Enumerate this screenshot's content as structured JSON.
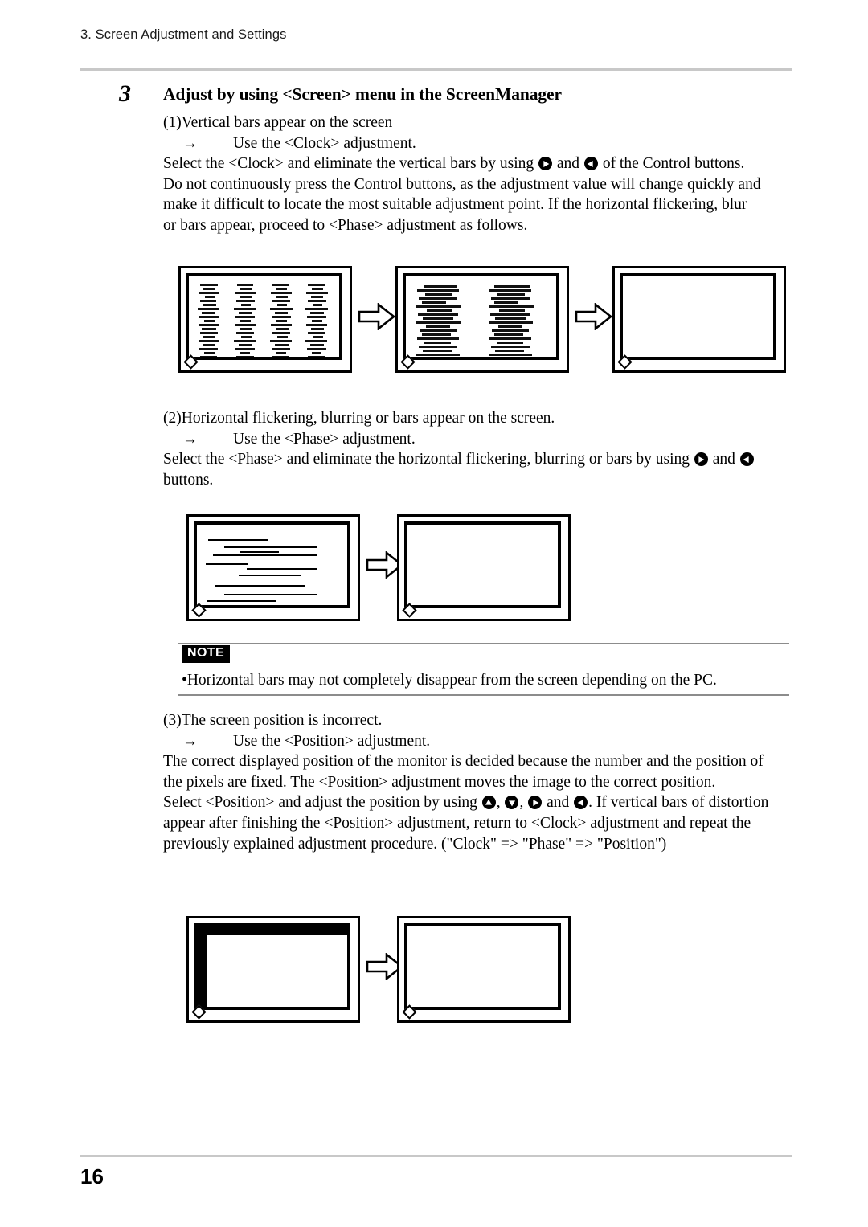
{
  "document": {
    "running_head": "3. Screen Adjustment and Settings",
    "page_number": "16"
  },
  "step": {
    "number": "3",
    "title": "Adjust by using <Screen> menu in the ScreenManager"
  },
  "sections": [
    {
      "id": "clock",
      "heading": "(1)Vertical bars appear on the screen",
      "arrow_symbol": "→",
      "arrow_instruction": "Use the <Clock> adjustment.",
      "paragraph_lines": [
        "Select the <Clock> and eliminate the vertical bars by using ",
        " and ",
        " of the Control buttons.",
        "Do not continuously press the Control buttons, as the adjustment value will change quickly and",
        "make it difficult to locate the most suitable adjustment point. If the horizontal flickering, blur",
        "or bars appear, proceed to <Phase> adjustment as follows."
      ],
      "buttons": [
        "right-control-button",
        "left-control-button"
      ]
    },
    {
      "id": "phase",
      "heading": "(2)Horizontal flickering, blurring or bars appear on the screen.",
      "arrow_symbol": "→",
      "arrow_instruction": "Use the <Phase> adjustment.",
      "paragraph_lines": [
        "Select the <Phase> and eliminate the horizontal flickering, blurring or bars by using ",
        " and ",
        "",
        "buttons."
      ],
      "buttons": [
        "right-control-button",
        "left-control-button"
      ]
    },
    {
      "id": "position",
      "heading": "(3)The screen position is incorrect.",
      "arrow_symbol": "→",
      "arrow_instruction": "Use the <Position> adjustment.",
      "paragraph_lines": [
        "The correct displayed position of the monitor is decided because the number and the position of",
        "the pixels are fixed. The <Position> adjustment moves the image to the correct position.",
        "Select <Position> and adjust the position by using ",
        ", ",
        ", ",
        " and ",
        ". If vertical bars of distortion",
        "appear after finishing the <Position> adjustment, return to <Clock> adjustment and repeat the",
        "previously explained adjustment procedure. (\"Clock\" => \"Phase\" => \"Position\")"
      ],
      "buttons": [
        "up-control-button",
        "down-control-button",
        "right-control-button",
        "left-control-button"
      ]
    }
  ],
  "note": {
    "label": "NOTE",
    "bullet": "•",
    "text": "Horizontal bars may not completely disappear from the screen depending on the PC."
  },
  "figures": [
    {
      "id": "clock-figure",
      "caption_state": [
        "vertical-bars-severe",
        "vertical-bars-reduced",
        "screen-clean"
      ],
      "arrow_symbol": "⇒"
    },
    {
      "id": "phase-figure",
      "caption_state": [
        "horizontal-bars",
        "screen-clean"
      ],
      "arrow_symbol": "⇒"
    },
    {
      "id": "position-figure",
      "caption_state": [
        "image-offset",
        "screen-clean"
      ],
      "arrow_symbol": "⇒"
    }
  ],
  "colors": {
    "ink": "#000000",
    "rule": "#c8c8c8",
    "note_rule": "#8c8c8c"
  }
}
